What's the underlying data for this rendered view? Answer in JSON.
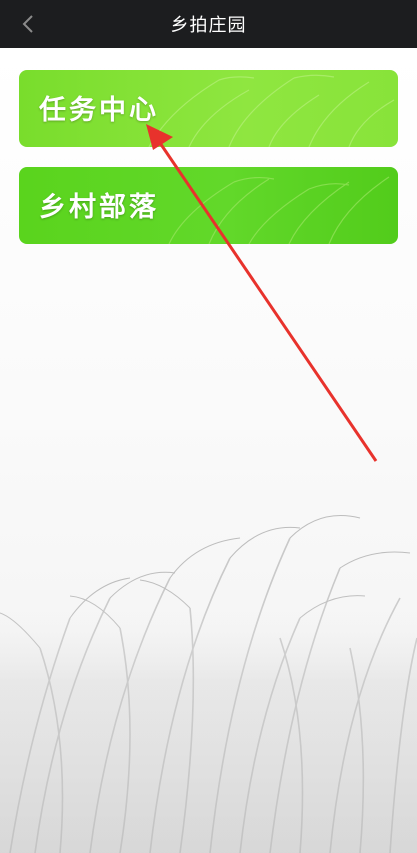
{
  "header": {
    "title": "乡拍庄园",
    "back_icon": "chevron-left-icon"
  },
  "menu": [
    {
      "label": "任务中心"
    },
    {
      "label": "乡村部落"
    }
  ],
  "colors": {
    "titlebar": "#1c1d1f",
    "card_primary": "#79dd2c",
    "card_secondary": "#5ad41d",
    "annotation_arrow": "#e8322c"
  }
}
